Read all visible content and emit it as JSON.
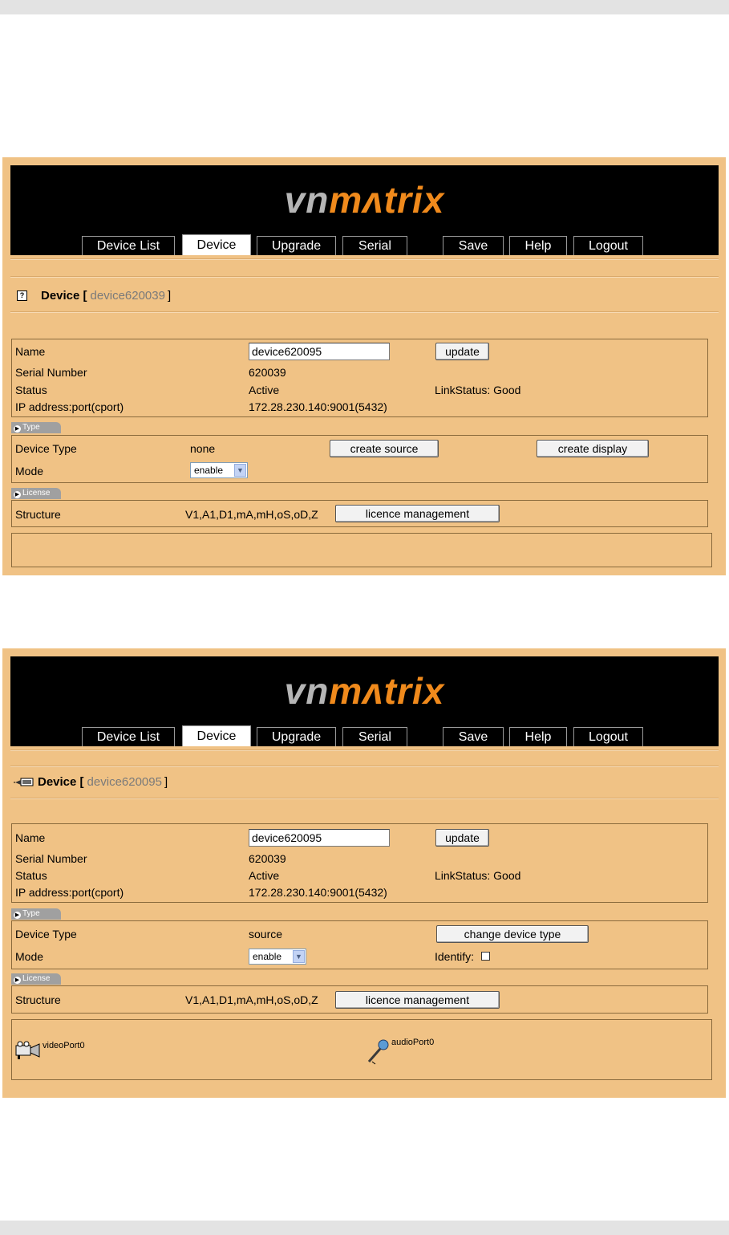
{
  "logo": {
    "vn": "vn",
    "matrix": "mʌtrix"
  },
  "nav": {
    "tabs": [
      "Device List",
      "Device",
      "Upgrade",
      "Serial",
      "Save",
      "Help",
      "Logout"
    ],
    "active": "Device"
  },
  "labels": {
    "device_title": "Device [",
    "device_close": "]",
    "name": "Name",
    "serial_number": "Serial Number",
    "status": "Status",
    "ip": "IP address:port(cport)",
    "device_type": "Device Type",
    "mode": "Mode",
    "structure": "Structure",
    "type_tab": "Type",
    "license_tab": "License",
    "identify": "Identify:"
  },
  "panel1": {
    "device_id": "device620039",
    "name_value": "device620095",
    "update_button": "update",
    "serial_number": "620039",
    "status": "Active",
    "link_status": "LinkStatus: Good",
    "ip": "172.28.230.140:9001(5432)",
    "device_type": "none",
    "create_source_button": "create source",
    "create_display_button": "create display",
    "mode": "enable",
    "structure": "V1,A1,D1,mA,mH,oS,oD,Z",
    "licence_button": "licence management"
  },
  "panel2": {
    "device_id": "device620095",
    "name_value": "device620095",
    "update_button": "update",
    "serial_number": "620039",
    "status": "Active",
    "link_status": "LinkStatus: Good",
    "ip": "172.28.230.140:9001(5432)",
    "device_type": "source",
    "change_type_button": "change device type",
    "mode": "enable",
    "structure": "V1,A1,D1,mA,mH,oS,oD,Z",
    "licence_button": "licence management",
    "ports": [
      "videoPort0",
      "audioPort0"
    ]
  }
}
